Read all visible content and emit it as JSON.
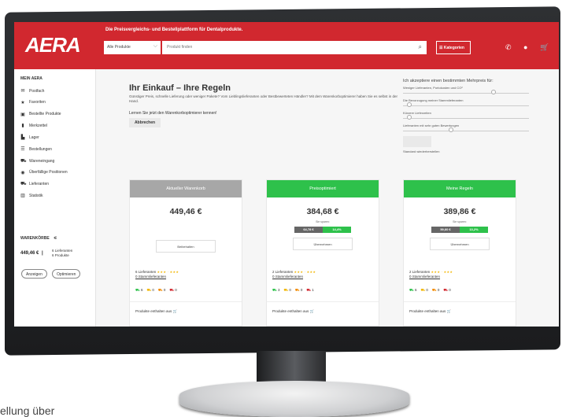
{
  "header": {
    "logo": "AERA",
    "tagline": "Die Preisvergleichs- und Bestellplattform für Dentalprodukte.",
    "category_select": "Alle Produkte",
    "search_placeholder": "Produkt finden",
    "categories_button": "Kategorien"
  },
  "sidebar": {
    "heading": "MEIN AERA",
    "items": [
      {
        "label": "Postfach",
        "icon": "mail-icon"
      },
      {
        "label": "Favoriten",
        "icon": "star-icon"
      },
      {
        "label": "Bestellte Produkte",
        "icon": "box-icon"
      },
      {
        "label": "Merkzettel",
        "icon": "bookmark-icon"
      },
      {
        "label": "Lager",
        "icon": "boxes-icon"
      },
      {
        "label": "Bestellungen",
        "icon": "list-icon"
      },
      {
        "label": "Wareneingang",
        "icon": "truck-incoming-icon"
      },
      {
        "label": "Überfällige Positionen",
        "icon": "alert-icon"
      },
      {
        "label": "Lieferanten",
        "icon": "truck-icon"
      },
      {
        "label": "Statistik",
        "icon": "chart-icon"
      }
    ],
    "baskets_heading": "WARENKÖRBE",
    "basket_total": "449,46 €",
    "basket_sep": "|",
    "basket_suppliers": "6 Lieferanten",
    "basket_products": "6 Produkte",
    "btn_show": "Anzeigen",
    "btn_optimize": "Optimieren"
  },
  "main": {
    "title": "Ihr Einkauf – Ihre Regeln",
    "intro": "Günstiger Preis, schnelle Lieferung oder weniger Pakete? Vom Lieblingslieferanten oder Bestbewerteten Händler? Mit dem Warenkorboptimierer haben Sie es selbst in der Hand.",
    "learn_more": "Lernen Sie jetzt den Warenkorboptimierer kennen!",
    "cancel_btn": "Abbrechen",
    "prefs": {
      "title": "Ich akzeptiere einen bestimmten Mehrpreis für:",
      "sliders": [
        {
          "label": "Weniger Lieferanten, Portokosten und CO²",
          "value": 0.72
        },
        {
          "label": "Die Bevorzugung meiner Stammlieferanten",
          "value": 0.05
        },
        {
          "label": "Kürzere Lieferzeiten",
          "value": 0.05
        },
        {
          "label": "Lieferanten mit sehr guten Bewertungen",
          "value": 0.38
        }
      ],
      "reset": "Standard wiederherstellen"
    },
    "columns": [
      {
        "head": "Aktueller Warenkorb",
        "head_color": "#a7a7a7",
        "price": "449,46 €",
        "save_label": "",
        "save_amount": "",
        "save_percent": "",
        "button": "Beibehalten",
        "suppliers": "6 Lieferanten",
        "stars": "★★★ · ★★★",
        "stamm": "0 Stammlieferanten",
        "trucks": [
          "6",
          "0",
          "0",
          "0"
        ],
        "footer": "Produkte enthalten aus"
      },
      {
        "head": "Preisoptimiert",
        "head_color": "#2ec14b",
        "price": "384,68 €",
        "save_label": "Sie sparen:",
        "save_amount": "64,78 €",
        "save_percent": "14,4%",
        "button": "Übernehmen",
        "suppliers": "2 Lieferanten",
        "stars": "★★★ · ★★★",
        "stamm": "0 Stammlieferanten",
        "trucks": [
          "3",
          "0",
          "0",
          "1"
        ],
        "footer": "Produkte enthalten aus"
      },
      {
        "head": "Meine Regeln",
        "head_color": "#2ec14b",
        "price": "389,86 €",
        "save_label": "Sie sparen:",
        "save_amount": "59,60 €",
        "save_percent": "13,2%",
        "button": "Übernehmen",
        "suppliers": "2 Lieferanten",
        "stars": "★★★ · ★★★",
        "stamm": "0 Stammlieferanten",
        "trucks": [
          "6",
          "0",
          "0",
          "0"
        ],
        "footer": "Produkte enthalten aus"
      }
    ]
  },
  "background_text": "ellung über"
}
